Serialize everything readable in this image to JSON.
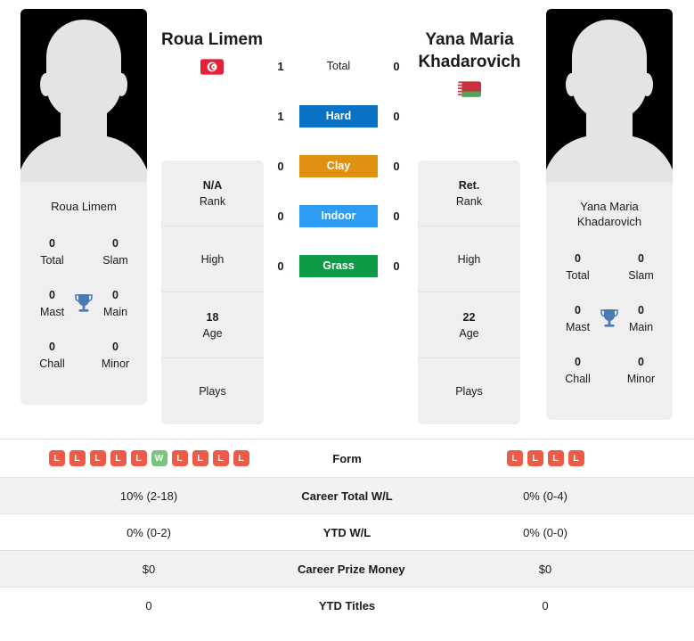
{
  "players": {
    "left": {
      "name": "Roua Limem",
      "card_name": "Roua Limem",
      "flag": "tunisia-flag",
      "titles": [
        {
          "value": "0",
          "label": "Total"
        },
        {
          "value": "0",
          "label": "Slam"
        },
        {
          "value": "0",
          "label": "Mast"
        },
        {
          "value": "0",
          "label": "Main"
        },
        {
          "value": "0",
          "label": "Chall"
        },
        {
          "value": "0",
          "label": "Minor"
        }
      ],
      "info": [
        {
          "value": "N/A",
          "label": "Rank"
        },
        {
          "value": "",
          "label": "High"
        },
        {
          "value": "18",
          "label": "Age"
        },
        {
          "value": "",
          "label": "Plays"
        }
      ],
      "form": [
        "L",
        "L",
        "L",
        "L",
        "L",
        "W",
        "L",
        "L",
        "L",
        "L"
      ]
    },
    "right": {
      "name": "Yana Maria Khadarovich",
      "card_name": "Yana Maria Khadarovich",
      "flag": "belarus-flag",
      "titles": [
        {
          "value": "0",
          "label": "Total"
        },
        {
          "value": "0",
          "label": "Slam"
        },
        {
          "value": "0",
          "label": "Mast"
        },
        {
          "value": "0",
          "label": "Main"
        },
        {
          "value": "0",
          "label": "Chall"
        },
        {
          "value": "0",
          "label": "Minor"
        }
      ],
      "info": [
        {
          "value": "Ret.",
          "label": "Rank"
        },
        {
          "value": "",
          "label": "High"
        },
        {
          "value": "22",
          "label": "Age"
        },
        {
          "value": "",
          "label": "Plays"
        }
      ],
      "form": [
        "L",
        "L",
        "L",
        "L"
      ]
    }
  },
  "surfaces": [
    {
      "label": "Total",
      "left": "1",
      "right": "0",
      "color": "transparent"
    },
    {
      "label": "Hard",
      "left": "1",
      "right": "0",
      "color": "#0a72c4"
    },
    {
      "label": "Clay",
      "left": "0",
      "right": "0",
      "color": "#e09112"
    },
    {
      "label": "Indoor",
      "left": "0",
      "right": "0",
      "color": "#2f9cf4"
    },
    {
      "label": "Grass",
      "left": "0",
      "right": "0",
      "color": "#0f9b46"
    }
  ],
  "table": {
    "form_label": "Form",
    "rows": [
      {
        "label": "Career Total W/L",
        "left": "10% (2-18)",
        "right": "0% (0-4)"
      },
      {
        "label": "YTD W/L",
        "left": "0% (0-2)",
        "right": "0% (0-0)"
      },
      {
        "label": "Career Prize Money",
        "left": "$0",
        "right": "$0"
      },
      {
        "label": "YTD Titles",
        "left": "0",
        "right": "0"
      }
    ]
  },
  "colors": {
    "loss": "#ef5a46",
    "win": "#7ac47f",
    "card_bg": "#efefef",
    "trophy": "#4a79b5"
  }
}
